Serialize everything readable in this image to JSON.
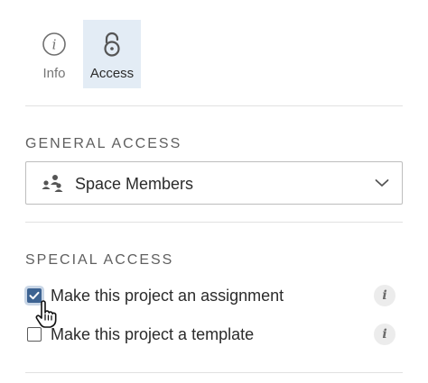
{
  "tabs": [
    {
      "label": "Info",
      "icon": "info-icon",
      "active": false
    },
    {
      "label": "Access",
      "icon": "lock-icon",
      "active": true
    }
  ],
  "general_access": {
    "title": "GENERAL ACCESS",
    "selected": "Space Members",
    "icon": "group-icon"
  },
  "special_access": {
    "title": "SPECIAL ACCESS",
    "options": [
      {
        "label": "Make this project an assignment",
        "checked": true
      },
      {
        "label": "Make this project a template",
        "checked": false
      }
    ]
  },
  "colors": {
    "accent": "#3d6392",
    "active_tab_bg": "#e3ecf5"
  }
}
